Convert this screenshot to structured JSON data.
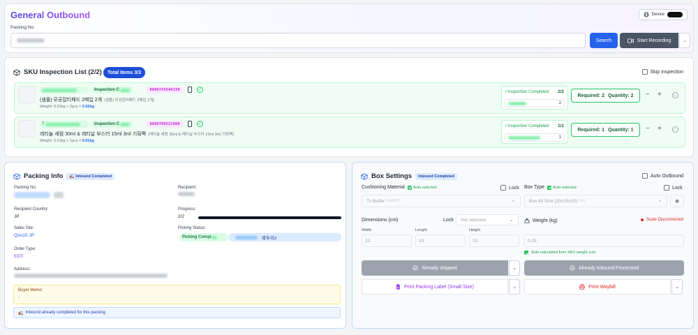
{
  "header": {
    "title": "General Outbound",
    "device_label": "Device",
    "packing_no_label": "Packing No",
    "search_label": "Search",
    "record_label": "Start Recording"
  },
  "sku_list": {
    "title": "SKU Inspection List (2/2)",
    "total_badge": "Total Items 3/3",
    "skip_label": "Skip Inspection",
    "items": [
      {
        "code_prefix": "",
        "insp_pill": "Inspection C",
        "barcode": "8809743546330",
        "name": "(샘플) 모공잡티패드 2매입 2개",
        "name_sub": "(샘플) 모공잡티패드 2매입 2개)",
        "weight": "Weight: 0.01kg × 2pcs = ",
        "weight_total": "0.02kg",
        "status_label": "✓Inspection Completed",
        "status_count": "2/2",
        "scanned": "2",
        "required": "Required: 2",
        "quantity": "Quantity: 2"
      },
      {
        "code_prefix": "7",
        "insp_pill": "Inspection C",
        "barcode": "8809700521888",
        "name": "레티놀 세럼 30ml & 레티날 부스터 15ml 3ml 기획팩",
        "name_sub": "(레티놀 세럼 30ml & 레티날 부스터 15ml 3ml 기획팩)",
        "weight": "Weight: 0.01kg × 1pcs = ",
        "weight_total": "0.01kg",
        "status_label": "✓Inspection Completed",
        "status_count": "1/1",
        "scanned": "1",
        "required": "Required: 1",
        "quantity": "Quantity: 1"
      }
    ]
  },
  "packing_info": {
    "title": "Packing Info",
    "badge": "Inbound Completed",
    "packing_no_label": "Packing No:",
    "recipient_label": "Recipient:",
    "country_label": "Recipient Country:",
    "country": "JP",
    "progress_label": "Progress:",
    "progress_text": "2/2",
    "progress_fraction": 1.0,
    "sales_site_label": "Sales Site:",
    "sales_site": "Qoo10 JP",
    "picking_status_label": "Picking Status:",
    "picking_status": "Picking Compl",
    "picker_name": "꽉두리z",
    "order_type_label": "Order Type:",
    "order_type": "EOT",
    "address_label": "Address:",
    "buyer_memo_label": "Buyer Memo",
    "buyer_memo": "-",
    "inbound_note": "Inbound already completed for this packing"
  },
  "box_settings": {
    "title": "Box Settings",
    "badge": "Inbound Completed",
    "auto_outbound_label": "Auto Outbound",
    "cushioning_label": "Cushioning Material",
    "auto_selected": "Auto-selected",
    "lock_label": "Lock",
    "cushioning_value": "Tx Buffer",
    "cushioning_code": "(WABP)",
    "box_type_label": "Box Type",
    "box_type_value": "Box 40 Size (20x15x10)",
    "box_type_code": "(19)",
    "dimensions_label": "Dimensions (cm)",
    "dim_lock_value": "Not selected",
    "weight_label": "Weight (kg)",
    "scale_status": "Scale Disconnected",
    "width_label": "Width",
    "length_label": "Length",
    "height_label": "Height",
    "width": "20",
    "length": "10",
    "height": "15",
    "weight": "0.25",
    "weight_auto_note": "Auto-calculated from SKU weight sum",
    "shipped_label": "Already shipped",
    "inbound_processed_label": "Already Inbound Processed",
    "print_label": "Print Packing Label (Small Size)",
    "waybill_label": "Print Waybill"
  },
  "colors": {
    "accent": "#2563eb",
    "success": "#16a34a",
    "danger": "#dc2626",
    "purple": "#9333ea"
  }
}
